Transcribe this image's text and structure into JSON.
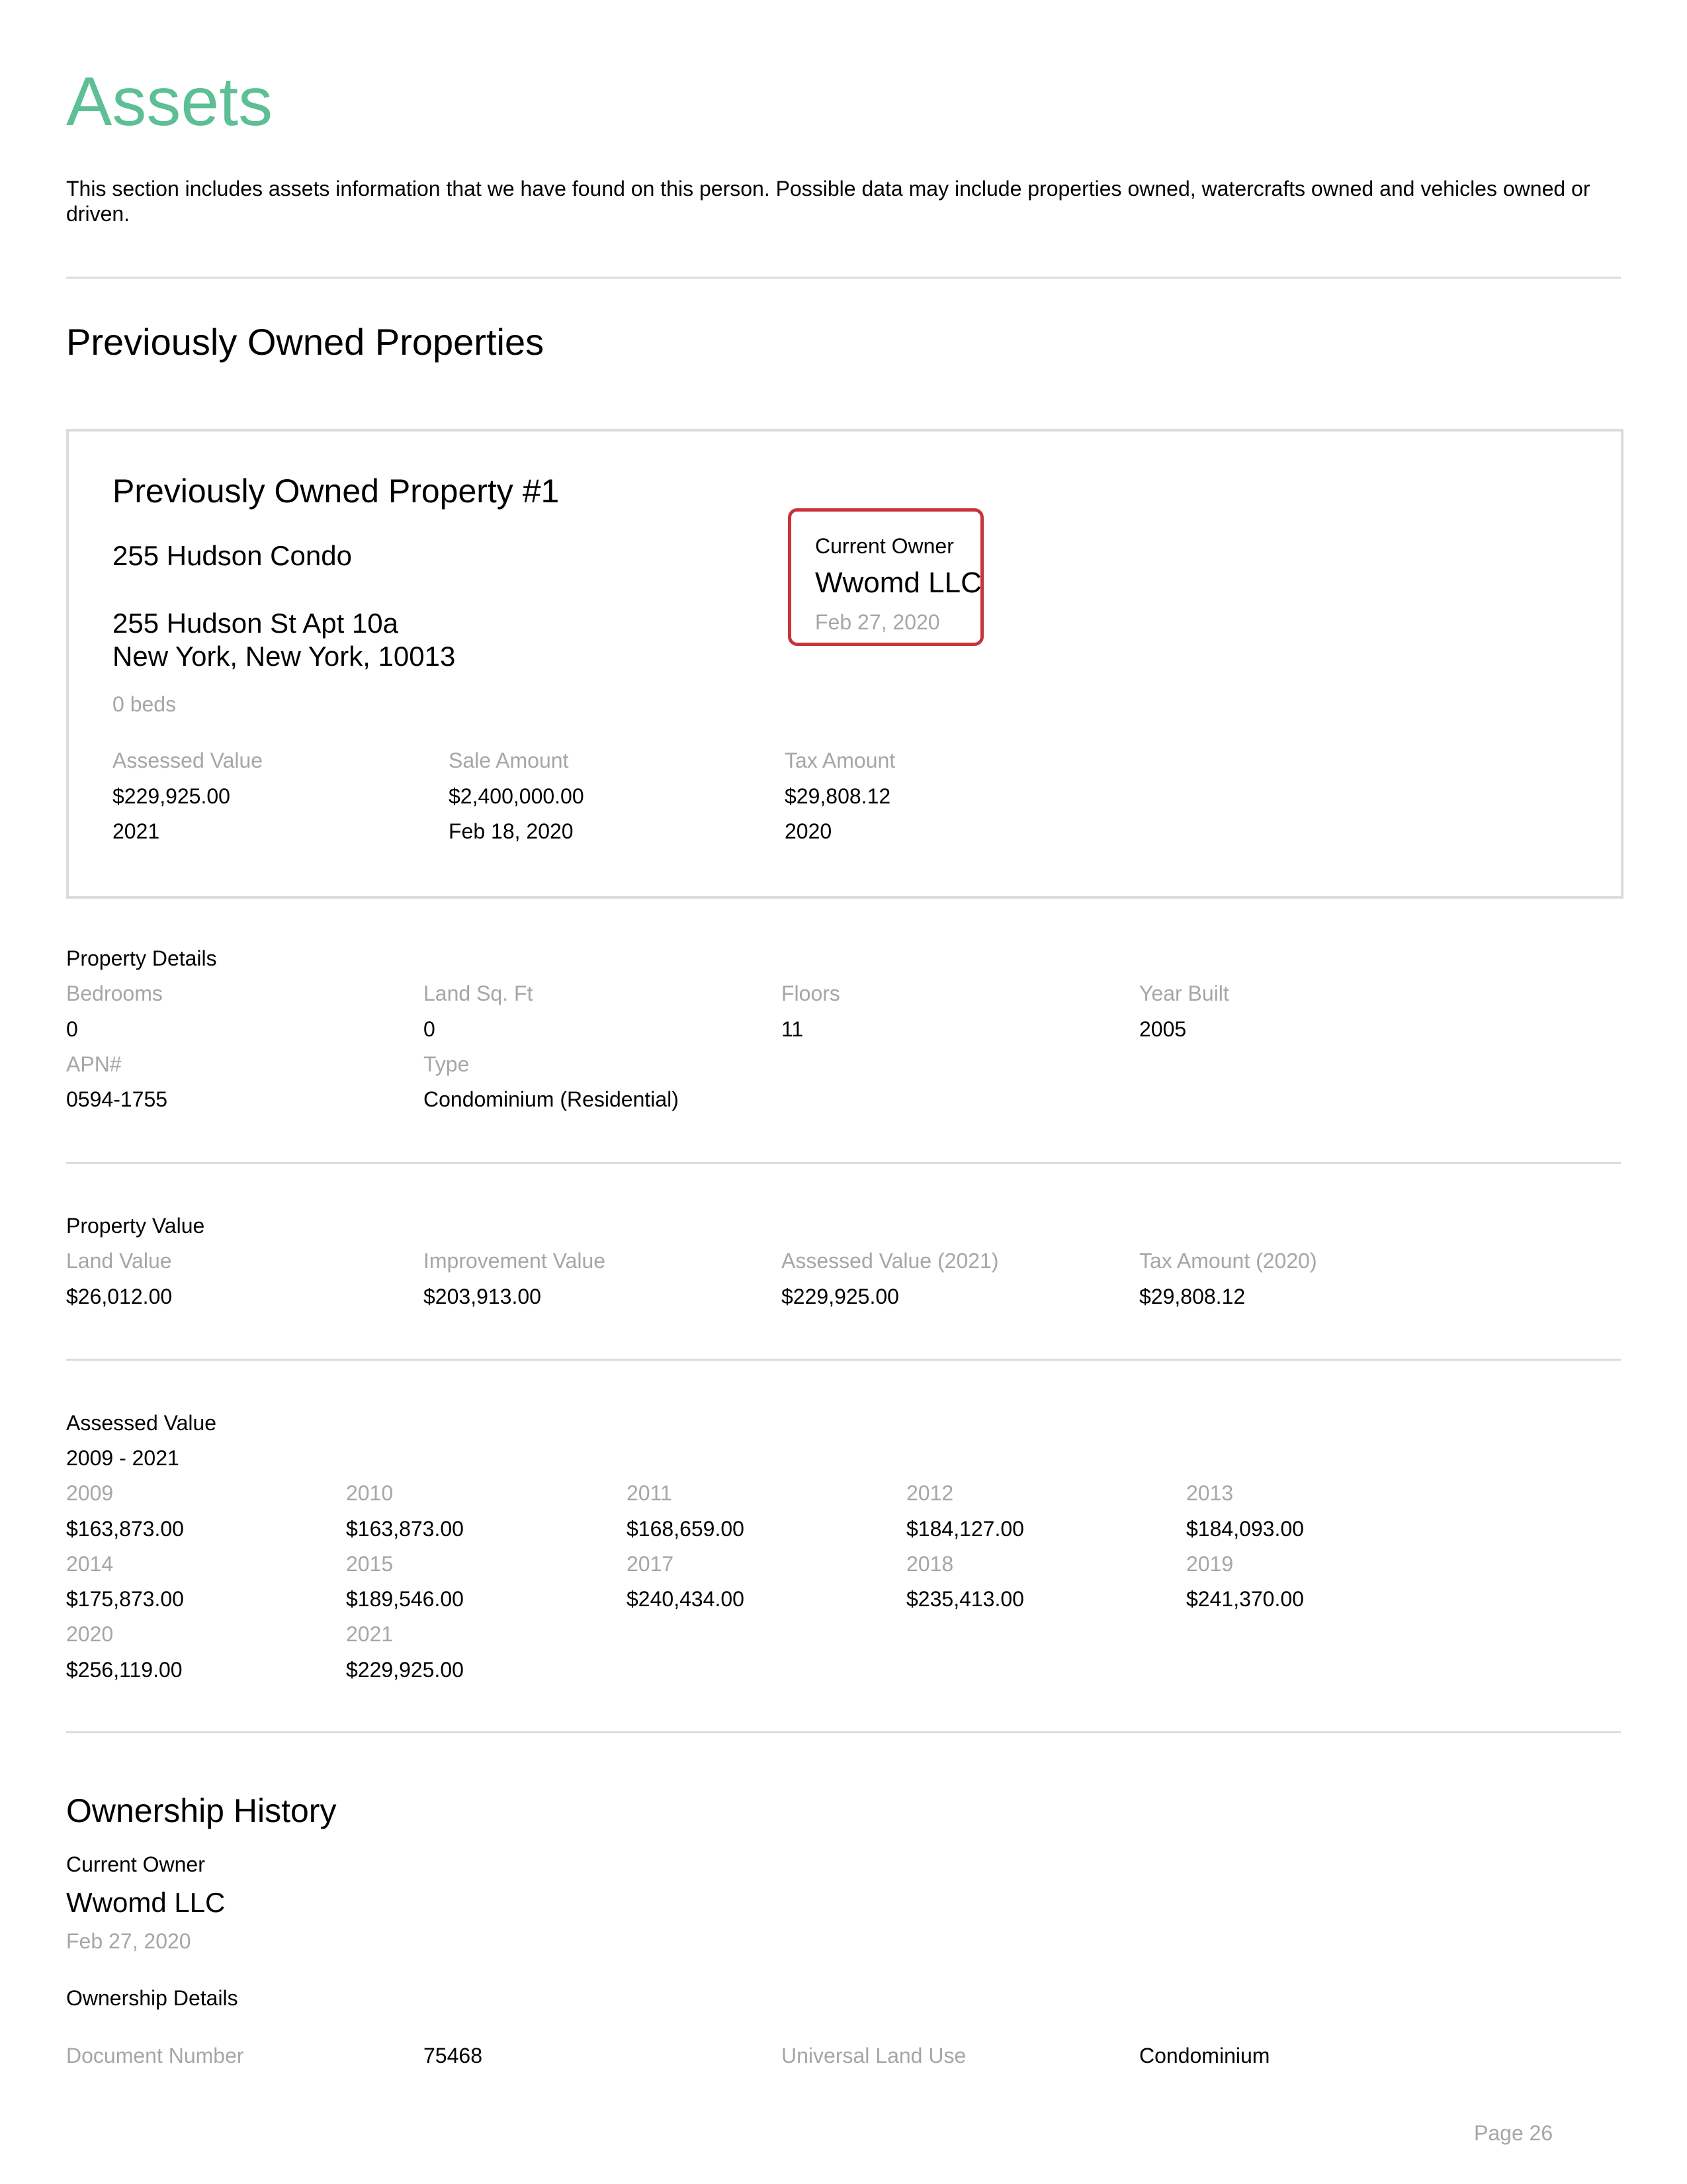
{
  "header": {
    "title": "Assets",
    "intro": "This section includes assets information that we have found on this person. Possible data may include properties owned, watercrafts owned and vehicles owned or driven."
  },
  "section_title": "Previously Owned Properties",
  "property": {
    "title": "Previously Owned Property #1",
    "name": "255 Hudson Condo",
    "address_line1": "255 Hudson St Apt 10a",
    "address_line2": "New York, New York, 10013",
    "beds": "0 beds",
    "current_owner": {
      "label": "Current Owner",
      "name": "Wwomd LLC",
      "date": "Feb 27, 2020"
    },
    "summary": {
      "assessed": {
        "label": "Assessed Value",
        "value": "$229,925.00",
        "year": "2021"
      },
      "sale": {
        "label": "Sale Amount",
        "value": "$2,400,000.00",
        "date": "Feb 18, 2020"
      },
      "tax": {
        "label": "Tax Amount",
        "value": "$29,808.12",
        "year": "2020"
      }
    }
  },
  "property_details": {
    "title": "Property Details",
    "bedrooms": {
      "label": "Bedrooms",
      "value": "0"
    },
    "land_sqft": {
      "label": "Land Sq. Ft",
      "value": "0"
    },
    "floors": {
      "label": "Floors",
      "value": "11"
    },
    "year_built": {
      "label": "Year Built",
      "value": "2005"
    },
    "apn": {
      "label": "APN#",
      "value": "0594-1755"
    },
    "type": {
      "label": "Type",
      "value": "Condominium (Residential)"
    }
  },
  "property_value": {
    "title": "Property Value",
    "land": {
      "label": "Land Value",
      "value": "$26,012.00"
    },
    "improvement": {
      "label": "Improvement Value",
      "value": "$203,913.00"
    },
    "assessed": {
      "label": "Assessed Value (2021)",
      "value": "$229,925.00"
    },
    "tax": {
      "label": "Tax Amount (2020)",
      "value": "$29,808.12"
    }
  },
  "assessed_history": {
    "title": "Assessed Value",
    "range": "2009 - 2021",
    "entries": [
      {
        "year": "2009",
        "value": "$163,873.00"
      },
      {
        "year": "2010",
        "value": "$163,873.00"
      },
      {
        "year": "2011",
        "value": "$168,659.00"
      },
      {
        "year": "2012",
        "value": "$184,127.00"
      },
      {
        "year": "2013",
        "value": "$184,093.00"
      },
      {
        "year": "2014",
        "value": "$175,873.00"
      },
      {
        "year": "2015",
        "value": "$189,546.00"
      },
      {
        "year": "2017",
        "value": "$240,434.00"
      },
      {
        "year": "2018",
        "value": "$235,413.00"
      },
      {
        "year": "2019",
        "value": "$241,370.00"
      },
      {
        "year": "2020",
        "value": "$256,119.00"
      },
      {
        "year": "2021",
        "value": "$229,925.00"
      }
    ]
  },
  "ownership_history": {
    "title": "Ownership History",
    "current_owner_label": "Current Owner",
    "owner_name": "Wwomd LLC",
    "owner_date": "Feb 27, 2020",
    "details_title": "Ownership Details",
    "document_number": {
      "label": "Document Number",
      "value": "75468"
    },
    "land_use": {
      "label": "Universal Land Use",
      "value": "Condominium"
    }
  },
  "footer": {
    "page": "Page 26"
  }
}
